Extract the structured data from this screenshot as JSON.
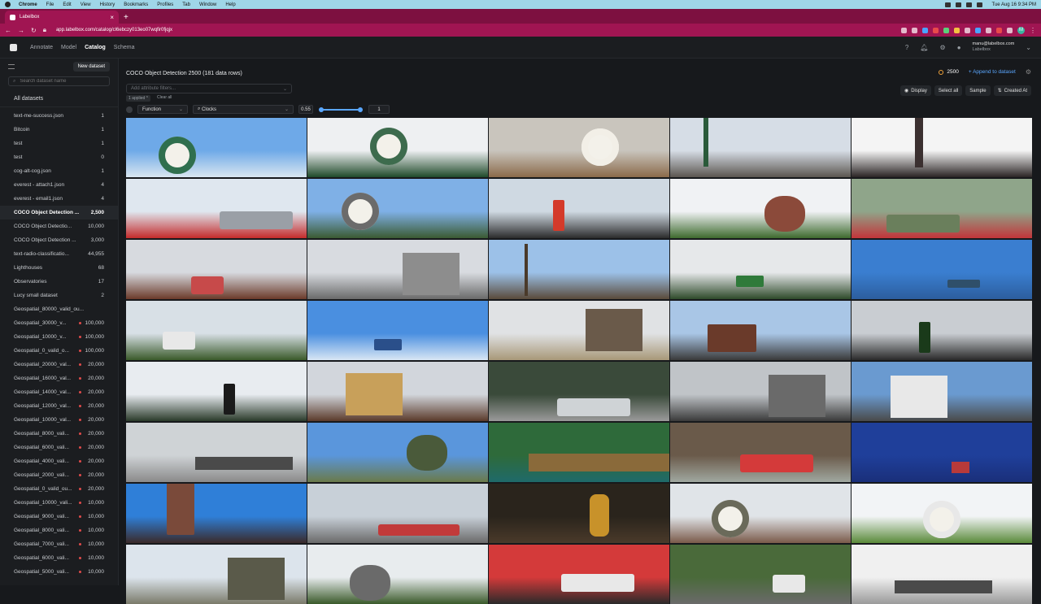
{
  "menubar": {
    "items": [
      "Chrome",
      "File",
      "Edit",
      "View",
      "History",
      "Bookmarks",
      "Profiles",
      "Tab",
      "Window",
      "Help"
    ],
    "clock": "Tue Aug 16  9:34 PM"
  },
  "browser": {
    "tab_title": "Labelbox",
    "url": "app.labelbox.com/catalog/cl6ebczy013eo07wqfir0fjqjx",
    "avatar_letter": "M"
  },
  "app": {
    "nav": [
      "Annotate",
      "Model",
      "Catalog",
      "Schema"
    ],
    "active_nav": "Catalog",
    "user_email": "manu@labelbox.com",
    "user_org": "Labelbox"
  },
  "sidebar": {
    "new_dataset": "New dataset",
    "search_placeholder": "Search dataset name",
    "all_datasets": "All datasets",
    "items": [
      {
        "name": "text-me-success.json",
        "count": "1",
        "dot": false
      },
      {
        "name": "Bitcoin",
        "count": "1",
        "dot": false
      },
      {
        "name": "test",
        "count": "1",
        "dot": false
      },
      {
        "name": "test",
        "count": "0",
        "dot": false
      },
      {
        "name": "cog-alt-cog.json",
        "count": "1",
        "dot": false
      },
      {
        "name": "everest - attach1.json",
        "count": "4",
        "dot": false
      },
      {
        "name": "everest - email1.json",
        "count": "4",
        "dot": false
      },
      {
        "name": "COCO Object Detection ...",
        "count": "2,500",
        "dot": false,
        "active": true
      },
      {
        "name": "COCO Object Detectio...",
        "count": "10,000",
        "dot": false
      },
      {
        "name": "COCO Object Detection ...",
        "count": "3,000",
        "dot": false
      },
      {
        "name": "text-radio-classificatio...",
        "count": "44,955",
        "dot": false
      },
      {
        "name": "Lighthouses",
        "count": "68",
        "dot": false
      },
      {
        "name": "Observatories",
        "count": "17",
        "dot": false
      },
      {
        "name": "Lucy small dataset",
        "count": "2",
        "dot": false
      },
      {
        "name": "Geospatial_80000_valid_ou...",
        "count": "",
        "dot": false
      },
      {
        "name": "Geospatial_30000_v...",
        "count": "100,000",
        "dot": true
      },
      {
        "name": "Geospatial_10000_v...",
        "count": "100,000",
        "dot": true
      },
      {
        "name": "Geospatial_0_valid_o...",
        "count": "100,000",
        "dot": true
      },
      {
        "name": "Geospatial_20000_val...",
        "count": "20,000",
        "dot": true
      },
      {
        "name": "Geospatial_16000_val...",
        "count": "20,000",
        "dot": true
      },
      {
        "name": "Geospatial_14000_val...",
        "count": "20,000",
        "dot": true
      },
      {
        "name": "Geospatial_12000_val...",
        "count": "20,000",
        "dot": true
      },
      {
        "name": "Geospatial_10000_val...",
        "count": "20,000",
        "dot": true
      },
      {
        "name": "Geospatial_8000_vali...",
        "count": "20,000",
        "dot": true
      },
      {
        "name": "Geospatial_6000_vali...",
        "count": "20,000",
        "dot": true
      },
      {
        "name": "Geospatial_4000_vali...",
        "count": "20,000",
        "dot": true
      },
      {
        "name": "Geospatial_2000_vali...",
        "count": "20,000",
        "dot": true
      },
      {
        "name": "Geospatial_0_valid_ou...",
        "count": "20,000",
        "dot": true
      },
      {
        "name": "Geospatial_10000_vali...",
        "count": "10,000",
        "dot": true
      },
      {
        "name": "Geospatial_9000_vali...",
        "count": "10,000",
        "dot": true
      },
      {
        "name": "Geospatial_8000_vali...",
        "count": "10,000",
        "dot": true
      },
      {
        "name": "Geospatial_7000_vali...",
        "count": "10,000",
        "dot": true
      },
      {
        "name": "Geospatial_6000_vali...",
        "count": "10,000",
        "dot": true
      },
      {
        "name": "Geospatial_5000_vali...",
        "count": "10,000",
        "dot": true
      }
    ]
  },
  "main": {
    "title": "COCO Object Detection 2500 (181 data rows)",
    "count": "2500",
    "append": "Append to dataset",
    "attr_placeholder": "Add attribute filters...",
    "applied": "1 applied",
    "clear": "Clear all",
    "display": "Display",
    "select_all": "Select all",
    "sample": "Sample",
    "created_at": "Created At",
    "filter": {
      "fn": "Function",
      "query": "Clocks",
      "threshold": "0.55",
      "top": "1"
    },
    "threshold_value": 0.55
  },
  "colors": {
    "accent": "#5aa7ff",
    "tab": "#a01552",
    "status_dot": "#e04a4a"
  },
  "thumbnails": [
    {
      "sky": "#6ea9e8",
      "ground": "#d9e6f0",
      "obj": "#2f6f4e",
      "kind": "clock"
    },
    {
      "sky": "#eef0f2",
      "ground": "#1f4a2a",
      "obj": "#3d6b4d",
      "kind": "clock"
    },
    {
      "sky": "#c9c5bd",
      "ground": "#8b6a4a",
      "obj": "#f2efe7",
      "kind": "clock"
    },
    {
      "sky": "#d6dde6",
      "ground": "#5b5650",
      "obj": "#2a5a3a",
      "kind": "pole"
    },
    {
      "sky": "#f4f4f4",
      "ground": "#2a2424",
      "obj": "#3b3030",
      "kind": "spire"
    },
    {
      "sky": "#dfe7ef",
      "ground": "#c42b2b",
      "obj": "#9a9fa6",
      "kind": "bus"
    },
    {
      "sky": "#7fb0e6",
      "ground": "#3b5a32",
      "obj": "#6b6b6b",
      "kind": "clock"
    },
    {
      "sky": "#cfd9e2",
      "ground": "#2c2c2c",
      "obj": "#d43a2a",
      "kind": "lights"
    },
    {
      "sky": "#f0f2f4",
      "ground": "#3e6a2e",
      "obj": "#8b4a3a",
      "kind": "tree"
    },
    {
      "sky": "#8fa58a",
      "ground": "#c2353a",
      "obj": "#6a7f5c",
      "kind": "bus"
    },
    {
      "sky": "#d7dadf",
      "ground": "#6b3a2a",
      "obj": "#c74a4a",
      "kind": "sign"
    },
    {
      "sky": "#d8dbe0",
      "ground": "#6a6a6a",
      "obj": "#8d8d8d",
      "kind": "building"
    },
    {
      "sky": "#9cc1e8",
      "ground": "#5a4a3a",
      "obj": "#4a3a2a",
      "kind": "poles"
    },
    {
      "sky": "#e6e8ea",
      "ground": "#2e4a2a",
      "obj": "#2f7a3a",
      "kind": "signs"
    },
    {
      "sky": "#3a7ed0",
      "ground": "#2c5e9e",
      "obj": "#2f4f6a",
      "kind": "streetsign"
    },
    {
      "sky": "#d8e0e6",
      "ground": "#3a5a2a",
      "obj": "#e8e8e8",
      "kind": "sign"
    },
    {
      "sky": "#4a8fe0",
      "ground": "#d8e6f4",
      "obj": "#2a4f8a",
      "kind": "signs"
    },
    {
      "sky": "#e0e2e4",
      "ground": "#a89878",
      "obj": "#6a5a4a",
      "kind": "building"
    },
    {
      "sky": "#a9c6e6",
      "ground": "#3a3a3a",
      "obj": "#6a3a2a",
      "kind": "house"
    },
    {
      "sky": "#c9cdd2",
      "ground": "#2a2a2a",
      "obj": "#1a3a1a",
      "kind": "lights"
    },
    {
      "sky": "#e8ecf0",
      "ground": "#2a3a2a",
      "obj": "#1a1a1a",
      "kind": "lights"
    },
    {
      "sky": "#d2d6dc",
      "ground": "#5a3a2a",
      "obj": "#c8a05a",
      "kind": "building"
    },
    {
      "sky": "#3a4a3a",
      "ground": "#9a9a9a",
      "obj": "#cfd3d6",
      "kind": "bus"
    },
    {
      "sky": "#c0c4c8",
      "ground": "#3a3a3a",
      "obj": "#6a6a6a",
      "kind": "building"
    },
    {
      "sky": "#6a9ad0",
      "ground": "#4a4a4a",
      "obj": "#e8e8e8",
      "kind": "building"
    },
    {
      "sky": "#cfd3d6",
      "ground": "#8a8a8a",
      "obj": "#4a4a4a",
      "kind": "street"
    },
    {
      "sky": "#5a96dc",
      "ground": "#6a7a4a",
      "obj": "#4a5a3a",
      "kind": "tree"
    },
    {
      "sky": "#2e6a3a",
      "ground": "#1f6a6a",
      "obj": "#8a6a3a",
      "kind": "water"
    },
    {
      "sky": "#6a5a4a",
      "ground": "#a0a8a0",
      "obj": "#d43a3a",
      "kind": "bus"
    },
    {
      "sky": "#1f3f9a",
      "ground": "#1a2f7a",
      "obj": "#b83a3a",
      "kind": "flag"
    },
    {
      "sky": "#2f7fd8",
      "ground": "#3a2a2a",
      "obj": "#7a4a3a",
      "kind": "tower"
    },
    {
      "sky": "#c8d0d8",
      "ground": "#6a6a6a",
      "obj": "#c23a3a",
      "kind": "train"
    },
    {
      "sky": "#2a241c",
      "ground": "#4a3a2a",
      "obj": "#c8922a",
      "kind": "statue"
    },
    {
      "sky": "#e0e4e8",
      "ground": "#7a5a4a",
      "obj": "#6a6a5a",
      "kind": "clock"
    },
    {
      "sky": "#f2f4f6",
      "ground": "#5a8a3a",
      "obj": "#e8e8e8",
      "kind": "clock"
    },
    {
      "sky": "#dce4ec",
      "ground": "#7a7a6a",
      "obj": "#5a5a4a",
      "kind": "building"
    },
    {
      "sky": "#e8ecee",
      "ground": "#3a5a2a",
      "obj": "#6a6a6a",
      "kind": "tree"
    },
    {
      "sky": "#d43a3a",
      "ground": "#2a2a2a",
      "obj": "#e8e8e8",
      "kind": "bus"
    },
    {
      "sky": "#4a6a3a",
      "ground": "#6a6a6a",
      "obj": "#e8e8e8",
      "kind": "sign"
    },
    {
      "sky": "#f0f0f0",
      "ground": "#9a9a9a",
      "obj": "#4a4a4a",
      "kind": "street"
    }
  ]
}
